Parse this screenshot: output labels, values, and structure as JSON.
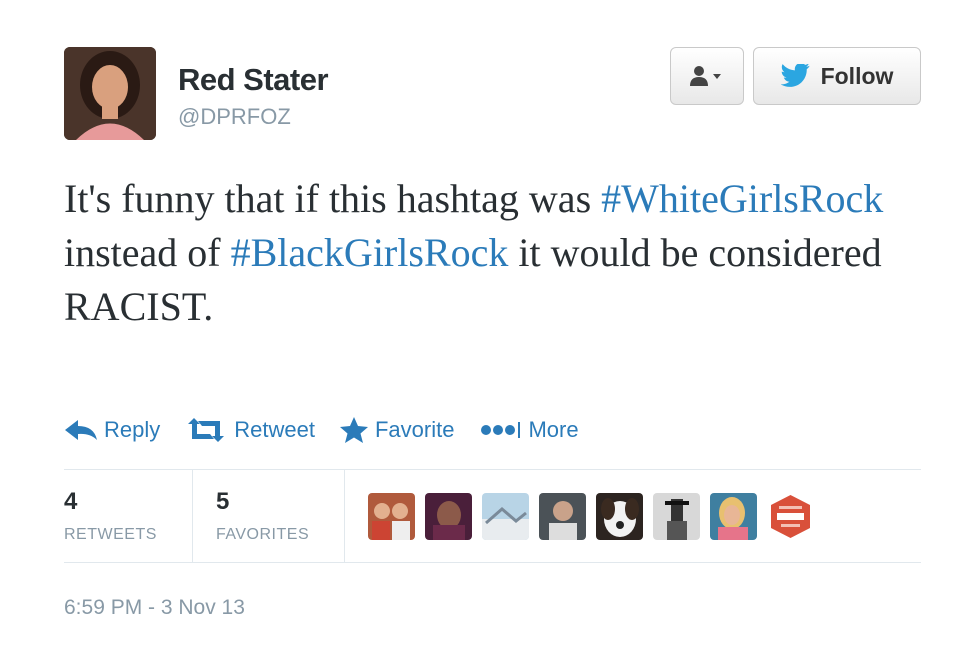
{
  "author": {
    "name": "Red Stater",
    "handle": "@DPRFOZ"
  },
  "buttons": {
    "follow_label": "Follow"
  },
  "tweet": {
    "segments": [
      {
        "text": "It's funny that if this hashtag was ",
        "hashtag": false
      },
      {
        "text": "#WhiteGirlsRock",
        "hashtag": true
      },
      {
        "text": " instead of ",
        "hashtag": false
      },
      {
        "text": "#BlackGirlsRock",
        "hashtag": true
      },
      {
        "text": " it would be considered RACIST.",
        "hashtag": false
      }
    ]
  },
  "actions": {
    "reply": "Reply",
    "retweet": "Retweet",
    "favorite": "Favorite",
    "more": "More"
  },
  "stats": {
    "retweets_count": "4",
    "retweets_label": "RETWEETS",
    "favorites_count": "5",
    "favorites_label": "FAVORITES"
  },
  "favoriters": [
    {
      "name": "favoriter-avatar-1"
    },
    {
      "name": "favoriter-avatar-2"
    },
    {
      "name": "favoriter-avatar-3"
    },
    {
      "name": "favoriter-avatar-4"
    },
    {
      "name": "favoriter-avatar-5"
    },
    {
      "name": "favoriter-avatar-6"
    },
    {
      "name": "favoriter-avatar-7"
    },
    {
      "name": "favoriter-avatar-8"
    }
  ],
  "timestamp": "6:59 PM - 3 Nov 13",
  "colors": {
    "link": "#2b7bb9",
    "muted": "#8899a6",
    "text": "#292f33"
  }
}
